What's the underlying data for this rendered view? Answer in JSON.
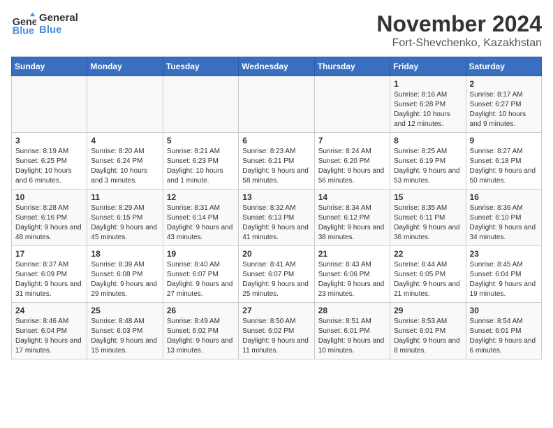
{
  "header": {
    "logo_general": "General",
    "logo_blue": "Blue",
    "month_title": "November 2024",
    "location": "Fort-Shevchenko, Kazakhstan"
  },
  "days_of_week": [
    "Sunday",
    "Monday",
    "Tuesday",
    "Wednesday",
    "Thursday",
    "Friday",
    "Saturday"
  ],
  "weeks": [
    [
      {
        "day": "",
        "content": ""
      },
      {
        "day": "",
        "content": ""
      },
      {
        "day": "",
        "content": ""
      },
      {
        "day": "",
        "content": ""
      },
      {
        "day": "",
        "content": ""
      },
      {
        "day": "1",
        "content": "Sunrise: 8:16 AM\nSunset: 6:28 PM\nDaylight: 10 hours and 12 minutes."
      },
      {
        "day": "2",
        "content": "Sunrise: 8:17 AM\nSunset: 6:27 PM\nDaylight: 10 hours and 9 minutes."
      }
    ],
    [
      {
        "day": "3",
        "content": "Sunrise: 8:19 AM\nSunset: 6:25 PM\nDaylight: 10 hours and 6 minutes."
      },
      {
        "day": "4",
        "content": "Sunrise: 8:20 AM\nSunset: 6:24 PM\nDaylight: 10 hours and 3 minutes."
      },
      {
        "day": "5",
        "content": "Sunrise: 8:21 AM\nSunset: 6:23 PM\nDaylight: 10 hours and 1 minute."
      },
      {
        "day": "6",
        "content": "Sunrise: 8:23 AM\nSunset: 6:21 PM\nDaylight: 9 hours and 58 minutes."
      },
      {
        "day": "7",
        "content": "Sunrise: 8:24 AM\nSunset: 6:20 PM\nDaylight: 9 hours and 56 minutes."
      },
      {
        "day": "8",
        "content": "Sunrise: 8:25 AM\nSunset: 6:19 PM\nDaylight: 9 hours and 53 minutes."
      },
      {
        "day": "9",
        "content": "Sunrise: 8:27 AM\nSunset: 6:18 PM\nDaylight: 9 hours and 50 minutes."
      }
    ],
    [
      {
        "day": "10",
        "content": "Sunrise: 8:28 AM\nSunset: 6:16 PM\nDaylight: 9 hours and 48 minutes."
      },
      {
        "day": "11",
        "content": "Sunrise: 8:29 AM\nSunset: 6:15 PM\nDaylight: 9 hours and 45 minutes."
      },
      {
        "day": "12",
        "content": "Sunrise: 8:31 AM\nSunset: 6:14 PM\nDaylight: 9 hours and 43 minutes."
      },
      {
        "day": "13",
        "content": "Sunrise: 8:32 AM\nSunset: 6:13 PM\nDaylight: 9 hours and 41 minutes."
      },
      {
        "day": "14",
        "content": "Sunrise: 8:34 AM\nSunset: 6:12 PM\nDaylight: 9 hours and 38 minutes."
      },
      {
        "day": "15",
        "content": "Sunrise: 8:35 AM\nSunset: 6:11 PM\nDaylight: 9 hours and 36 minutes."
      },
      {
        "day": "16",
        "content": "Sunrise: 8:36 AM\nSunset: 6:10 PM\nDaylight: 9 hours and 34 minutes."
      }
    ],
    [
      {
        "day": "17",
        "content": "Sunrise: 8:37 AM\nSunset: 6:09 PM\nDaylight: 9 hours and 31 minutes."
      },
      {
        "day": "18",
        "content": "Sunrise: 8:39 AM\nSunset: 6:08 PM\nDaylight: 9 hours and 29 minutes."
      },
      {
        "day": "19",
        "content": "Sunrise: 8:40 AM\nSunset: 6:07 PM\nDaylight: 9 hours and 27 minutes."
      },
      {
        "day": "20",
        "content": "Sunrise: 8:41 AM\nSunset: 6:07 PM\nDaylight: 9 hours and 25 minutes."
      },
      {
        "day": "21",
        "content": "Sunrise: 8:43 AM\nSunset: 6:06 PM\nDaylight: 9 hours and 23 minutes."
      },
      {
        "day": "22",
        "content": "Sunrise: 8:44 AM\nSunset: 6:05 PM\nDaylight: 9 hours and 21 minutes."
      },
      {
        "day": "23",
        "content": "Sunrise: 8:45 AM\nSunset: 6:04 PM\nDaylight: 9 hours and 19 minutes."
      }
    ],
    [
      {
        "day": "24",
        "content": "Sunrise: 8:46 AM\nSunset: 6:04 PM\nDaylight: 9 hours and 17 minutes."
      },
      {
        "day": "25",
        "content": "Sunrise: 8:48 AM\nSunset: 6:03 PM\nDaylight: 9 hours and 15 minutes."
      },
      {
        "day": "26",
        "content": "Sunrise: 8:49 AM\nSunset: 6:02 PM\nDaylight: 9 hours and 13 minutes."
      },
      {
        "day": "27",
        "content": "Sunrise: 8:50 AM\nSunset: 6:02 PM\nDaylight: 9 hours and 11 minutes."
      },
      {
        "day": "28",
        "content": "Sunrise: 8:51 AM\nSunset: 6:01 PM\nDaylight: 9 hours and 10 minutes."
      },
      {
        "day": "29",
        "content": "Sunrise: 8:53 AM\nSunset: 6:01 PM\nDaylight: 9 hours and 8 minutes."
      },
      {
        "day": "30",
        "content": "Sunrise: 8:54 AM\nSunset: 6:01 PM\nDaylight: 9 hours and 6 minutes."
      }
    ]
  ]
}
